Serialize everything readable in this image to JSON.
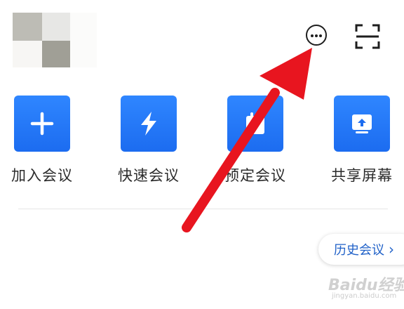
{
  "header": {
    "avatar_label": "avatar",
    "more_icon": "more-circle-icon",
    "scan_icon": "scan-icon"
  },
  "actions": [
    {
      "label": "加入会议",
      "icon": "plus-icon"
    },
    {
      "label": "快速会议",
      "icon": "lightning-icon"
    },
    {
      "label": "预定会议",
      "icon": "calendar-icon"
    },
    {
      "label": "共享屏幕",
      "icon": "share-screen-icon"
    }
  ],
  "history": {
    "label": "历史会议",
    "chevron": "›"
  },
  "watermark": {
    "text": "Baidu经验",
    "sub": "jingyan.baidu.com"
  },
  "colors": {
    "accent": "#1c6cf0",
    "arrow": "#e8151f",
    "history_text": "#2061c8"
  }
}
